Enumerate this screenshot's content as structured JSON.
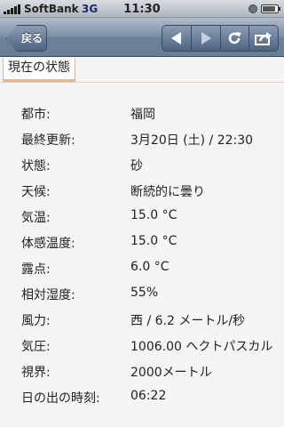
{
  "status_bar": {
    "carrier": "SoftBank",
    "network": "3G",
    "time": "11:30",
    "battery_level": 0.85
  },
  "nav": {
    "back_label": "戻る"
  },
  "tab": {
    "label": "現在の状態"
  },
  "weather": [
    {
      "label": "都市:",
      "value": "福岡"
    },
    {
      "label": "最終更新:",
      "value": "3月20日 (土) / 22:30"
    },
    {
      "label": "状態:",
      "value": "砂"
    },
    {
      "label": "天候:",
      "value": "断続的に曇り"
    },
    {
      "label": "気温:",
      "value": "15.0 °C"
    },
    {
      "label": "体感温度:",
      "value": "15.0 °C"
    },
    {
      "label": "露点:",
      "value": "6.0 °C"
    },
    {
      "label": "相対湿度:",
      "value": "55%"
    },
    {
      "label": "風力:",
      "value": "西 / 6.2 メートル/秒"
    },
    {
      "label": "気圧:",
      "value": "1006.00 ヘクトパスカル"
    },
    {
      "label": "視界:",
      "value": "2000メートル"
    },
    {
      "label": "日の出の時刻:",
      "value": "06:22"
    }
  ]
}
